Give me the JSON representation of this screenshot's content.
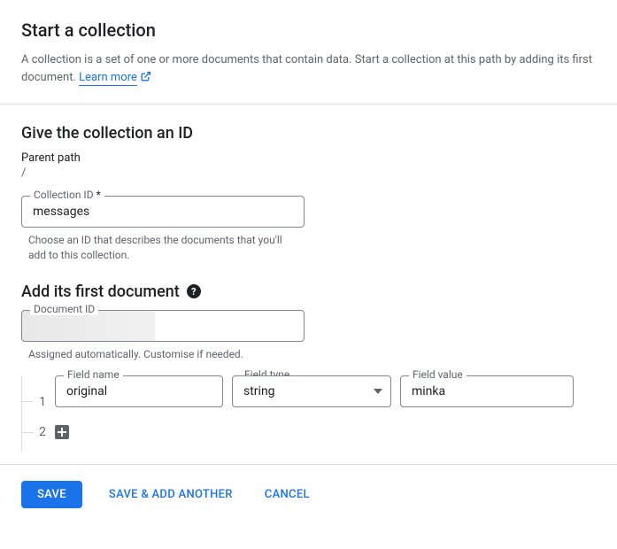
{
  "header": {
    "title": "Start a collection",
    "description": "A collection is a set of one or more documents that contain data. Start a collection at this path by adding its first document.",
    "learn_more": "Learn more"
  },
  "collection_section": {
    "heading": "Give the collection an ID",
    "parent_path_label": "Parent path",
    "parent_path_value": "/",
    "collection_id_label": "Collection ID",
    "required_marker": "*",
    "collection_id_value": "messages",
    "helper": "Choose an ID that describes the documents that you'll add to this collection."
  },
  "document_section": {
    "heading": "Add its first document",
    "doc_id_label": "Document ID",
    "doc_id_value": "",
    "doc_id_helper": "Assigned automatically. Customise if needed."
  },
  "fields": {
    "row1": {
      "index": "1",
      "name_label": "Field name",
      "name_value": "original",
      "type_label": "Field type",
      "type_value": "string",
      "value_label": "Field value",
      "value_value": "minka"
    },
    "row2": {
      "index": "2"
    }
  },
  "footer": {
    "save": "SAVE",
    "save_add": "SAVE & ADD ANOTHER",
    "cancel": "CANCEL"
  }
}
